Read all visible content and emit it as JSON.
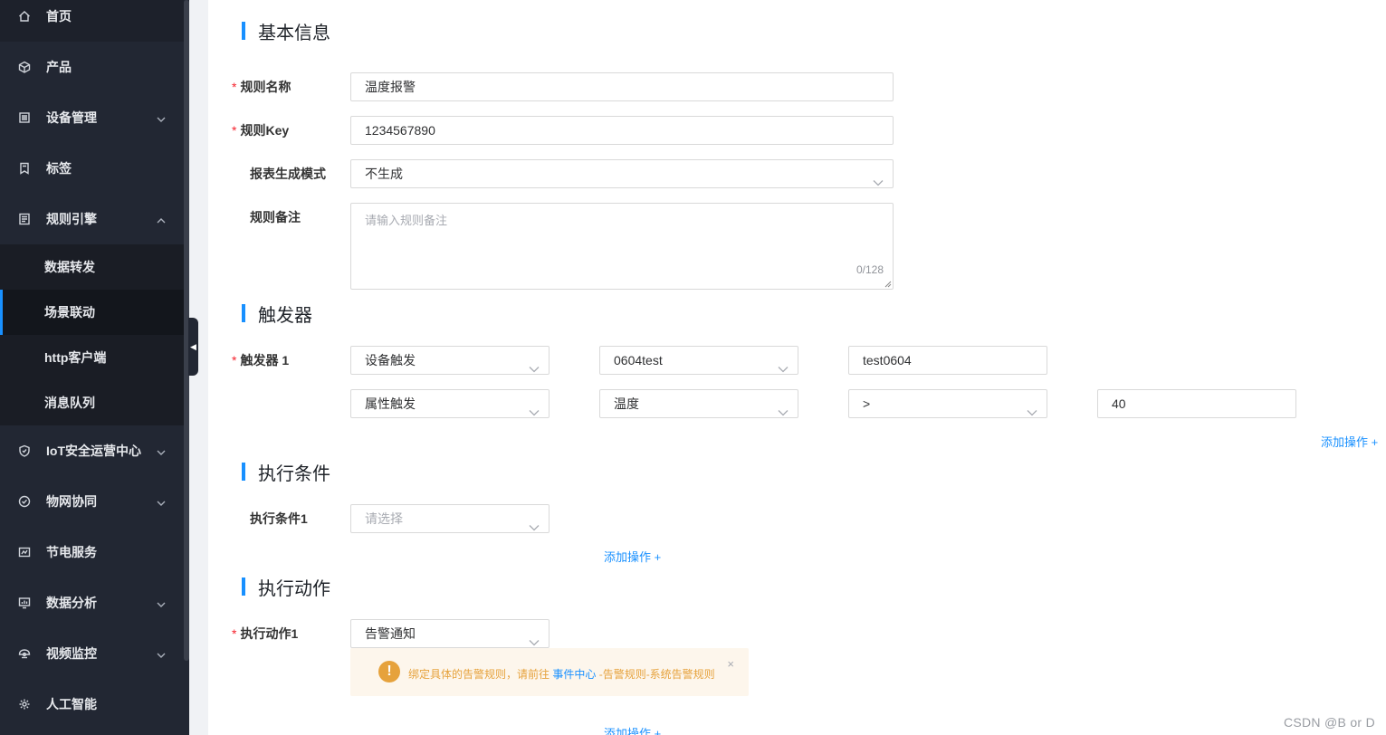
{
  "sidebar": {
    "items": [
      {
        "label": "首页",
        "icon": "home-icon",
        "expandable": false
      },
      {
        "label": "产品",
        "icon": "cube-icon",
        "expandable": false
      },
      {
        "label": "设备管理",
        "icon": "list-icon",
        "expandable": true
      },
      {
        "label": "标签",
        "icon": "bookmark-icon",
        "expandable": false
      },
      {
        "label": "规则引擎",
        "icon": "rules-icon",
        "expandable": true,
        "expanded": true
      },
      {
        "label": "IoT安全运营中心",
        "icon": "shield-icon",
        "expandable": true
      },
      {
        "label": "物网协同",
        "icon": "check-circle-icon",
        "expandable": true
      },
      {
        "label": "节电服务",
        "icon": "gauge-icon",
        "expandable": false
      },
      {
        "label": "数据分析",
        "icon": "chart-icon",
        "expandable": true
      },
      {
        "label": "视频监控",
        "icon": "camera-icon",
        "expandable": true
      },
      {
        "label": "人工智能",
        "icon": "gear-icon",
        "expandable": false
      }
    ],
    "sub_items": [
      {
        "label": "数据转发",
        "active": false
      },
      {
        "label": "场景联动",
        "active": true
      },
      {
        "label": "http客户端",
        "active": false
      },
      {
        "label": "消息队列",
        "active": false
      }
    ]
  },
  "sections": {
    "basic": "基本信息",
    "trigger": "触发器",
    "condition": "执行条件",
    "action": "执行动作"
  },
  "form": {
    "rule_name": {
      "label": "规则名称",
      "required": true,
      "value": "温度报警"
    },
    "rule_key": {
      "label": "规则Key",
      "required": true,
      "value": "1234567890"
    },
    "report_mode": {
      "label": "报表生成模式",
      "required": false,
      "value": "不生成"
    },
    "rule_note": {
      "label": "规则备注",
      "required": false,
      "placeholder": "请输入规则备注",
      "count": "0/128"
    },
    "trigger1": {
      "label": "触发器 1",
      "required": true,
      "type": "设备触发",
      "product": "0604test",
      "device": "test0604",
      "trigger_mode": "属性触发",
      "property": "温度",
      "operator": ">",
      "threshold": "40",
      "add_label": "添加操作 +"
    },
    "condition1": {
      "label": "执行条件1",
      "placeholder": "请选择",
      "add_label": "添加操作 +"
    },
    "action1": {
      "label": "执行动作1",
      "required": true,
      "value": "告警通知",
      "add_label": "添加操作 +"
    }
  },
  "alert": {
    "icon": "warning-icon",
    "text_before": "绑定具体的告警规则，请前往 ",
    "link": "事件中心",
    "text_after": " -告警规则-系统告警规则",
    "close": "×"
  },
  "required_mark": "*",
  "watermark": "CSDN @B    or    D"
}
